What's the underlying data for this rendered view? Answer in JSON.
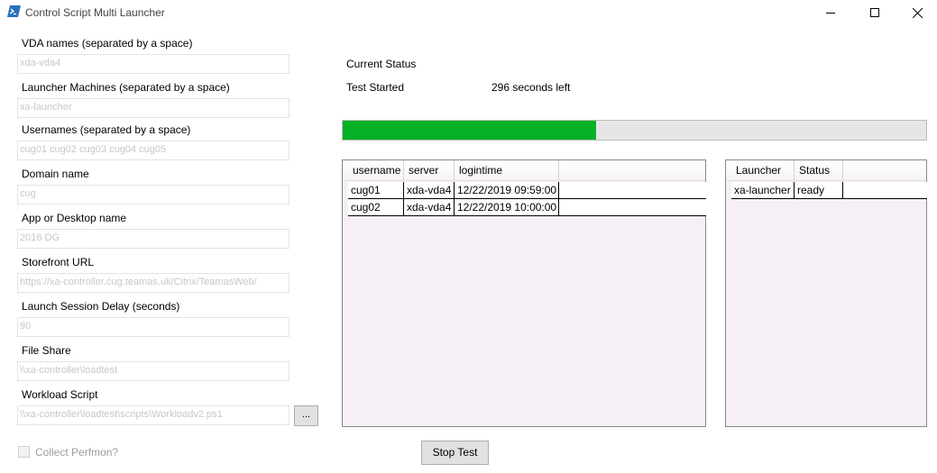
{
  "window": {
    "title": "Control Script Multi Launcher",
    "controls": [
      "minimize-icon",
      "maximize-icon",
      "close-icon"
    ]
  },
  "form": {
    "vda_names": {
      "label": "VDA names (separated by a space)",
      "value": "xda-vda4"
    },
    "launcher_machines": {
      "label": "Launcher Machines (separated by a space)",
      "value": "xa-launcher"
    },
    "usernames": {
      "label": "Usernames (separated by a space)",
      "value": "cug01 cug02 cug03 cug04 cug05"
    },
    "domain_name": {
      "label": "Domain name",
      "value": "cug"
    },
    "app_name": {
      "label": "App or Desktop name",
      "value": "2016 DG"
    },
    "storefront_url": {
      "label": "Storefront URL",
      "value": "https://xa-controller.cug.teamas.uk/Citrix/TeamasWeb/"
    },
    "launch_delay": {
      "label": "Launch Session Delay (seconds)",
      "value": "90"
    },
    "file_share": {
      "label": "File Share",
      "value": "\\\\xa-controller\\loadtest"
    },
    "workload_script": {
      "label": "Workload Script",
      "value": "\\\\xa-controller\\loadtest\\scripts\\Workloadv2.ps1"
    },
    "browse_label": "...",
    "collect_perfmon": {
      "label": "Collect Perfmon?",
      "checked": false
    }
  },
  "status": {
    "heading": "Current Status",
    "state": "Test Started",
    "time_left": "296 seconds left",
    "progress": 0.435,
    "progress_color": "#06b025"
  },
  "sessions": {
    "columns": [
      "username",
      "server",
      "logintime"
    ],
    "rows": [
      [
        "cug01",
        "xda-vda4",
        "12/22/2019 09:59:00"
      ],
      [
        "cug02",
        "xda-vda4",
        "12/22/2019 10:00:00"
      ]
    ]
  },
  "launchers": {
    "columns": [
      "Launcher",
      "Status"
    ],
    "rows": [
      [
        "xa-launcher",
        "ready"
      ]
    ]
  },
  "stop_button": "Stop Test"
}
